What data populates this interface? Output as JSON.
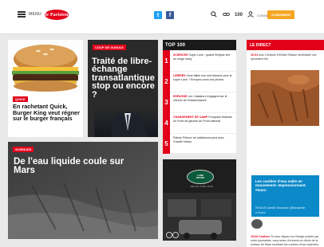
{
  "header": {
    "menu_label": "MENU",
    "logo_text": "le Parisien",
    "twitter_icon": "t",
    "facebook_icon": "f",
    "count_label": "100",
    "connexion_label": "CONNEXION",
    "abonner_label": "S'ABONNER"
  },
  "cards": [
    {
      "tag": "QUICK",
      "headline": "En rachetant Quick, Burger King veut régner sur le burger français"
    },
    {
      "tag": "COUP DE GUEULE",
      "headline": "Traité de libre-échange transatlantique stop ou encore ?"
    },
    {
      "tag": "SCIENCES",
      "headline": "De l'eau liquide coule sur Mars"
    }
  ],
  "top100": {
    "title": "TOP 100",
    "items": [
      {
        "num": "1",
        "cat": "Sciences",
        "text": "Super Lune : quand l'éclipse vire au rouge sang"
      },
      {
        "num": "2",
        "cat": "Libérés",
        "text": "Vous faites une nuit blanche pour la super Lune ? Envoyez-nous vos photos"
      },
      {
        "num": "3",
        "cat": "Espagne",
        "text": "Les Catalans s'engagent sur le chemin de l'indépendance"
      },
      {
        "num": "4",
        "cat": "Changement de camp",
        "text": "Françoise Mauriac du Front de gauche au Front national"
      },
      {
        "num": "5",
        "cat": "",
        "text": "Patrick Pelloux ne collaborera plus avec Charlie Hebdo"
      }
    ]
  },
  "ad": {
    "brand_line1": "LAND",
    "brand_line2": "ROVER",
    "tagline": "ABOVE & BEYOND"
  },
  "live": {
    "title": "LE DIRECT",
    "entry1_time": "10:31",
    "entry1_text": "Avis L'histoire d'Enfant Raison semblable une quinzaine fois",
    "tweet_text": "Les coulées d'eau salée en mouvement. Impressionnant. #mars",
    "tweet_meta": "09:06 25 Camille Gévaudan @libecamille",
    "tweet_like": "♥ Suivre",
    "entry2_time": "10:00",
    "entry2_cat": "Coulées",
    "entry2_text": "Si vous cliquez sur l'image postée par notre journaliste, vous serez d'ennemi un cliché de la surface de Mars montrant les coulées d'eau repérées par la Nasa sur la planète rouge."
  }
}
